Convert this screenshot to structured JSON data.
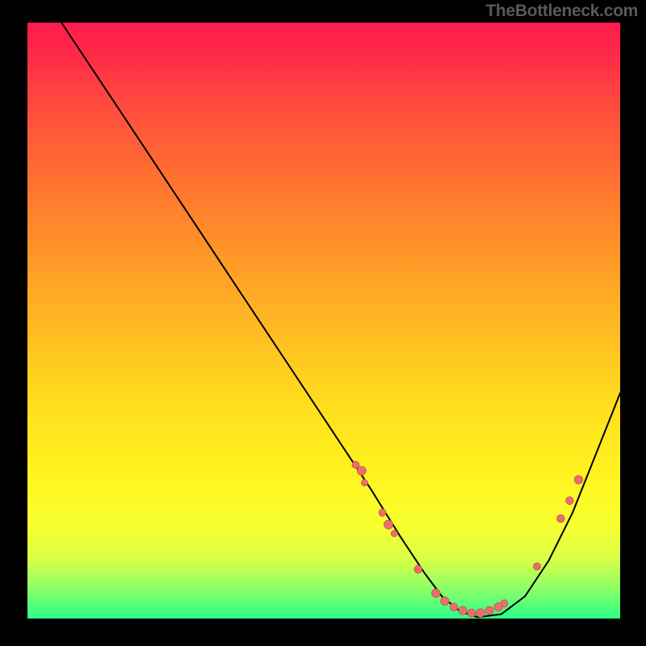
{
  "watermark": "TheBottleneck.com",
  "chart_data": {
    "type": "line",
    "title": "",
    "xlabel": "",
    "ylabel": "",
    "xlim": [
      0,
      100
    ],
    "ylim": [
      0,
      100
    ],
    "grid": false,
    "legend": false,
    "series": [
      {
        "name": "bottleneck-curve",
        "x": [
          6,
          10,
          16,
          22,
          28,
          34,
          40,
          46,
          52,
          58,
          63,
          67,
          70,
          73,
          76,
          80,
          84,
          88,
          92,
          96,
          100
        ],
        "y": [
          100,
          94,
          85,
          76,
          67,
          58,
          49,
          40,
          31,
          22,
          14,
          8,
          4,
          1.5,
          0.5,
          1,
          4,
          10,
          18,
          28,
          38
        ],
        "color": "#000000",
        "stroke_width": 2
      }
    ],
    "markers": [
      {
        "x": 55.5,
        "y": 26,
        "r": 4.5
      },
      {
        "x": 56.5,
        "y": 25,
        "r": 5.5
      },
      {
        "x": 57.0,
        "y": 23,
        "r": 4.0
      },
      {
        "x": 60.0,
        "y": 18,
        "r": 4.5
      },
      {
        "x": 61.0,
        "y": 16,
        "r": 5.5
      },
      {
        "x": 62.0,
        "y": 14.5,
        "r": 4.0
      },
      {
        "x": 66.0,
        "y": 8.5,
        "r": 4.8
      },
      {
        "x": 69.0,
        "y": 4.5,
        "r": 5.2
      },
      {
        "x": 70.5,
        "y": 3.2,
        "r": 5.2
      },
      {
        "x": 72.0,
        "y": 2.2,
        "r": 4.8
      },
      {
        "x": 73.5,
        "y": 1.6,
        "r": 5.2
      },
      {
        "x": 75.0,
        "y": 1.2,
        "r": 5.0
      },
      {
        "x": 76.5,
        "y": 1.2,
        "r": 5.2
      },
      {
        "x": 78.0,
        "y": 1.6,
        "r": 5.0
      },
      {
        "x": 79.5,
        "y": 2.2,
        "r": 5.2
      },
      {
        "x": 80.5,
        "y": 2.8,
        "r": 4.5
      },
      {
        "x": 86.0,
        "y": 9.0,
        "r": 4.5
      },
      {
        "x": 90.0,
        "y": 17.0,
        "r": 4.8
      },
      {
        "x": 91.5,
        "y": 20.0,
        "r": 4.8
      },
      {
        "x": 93.0,
        "y": 23.5,
        "r": 5.2
      }
    ],
    "marker_fill": "#e96f6c",
    "marker_stroke": "#c94f4c"
  }
}
